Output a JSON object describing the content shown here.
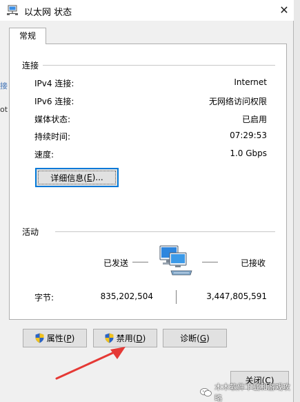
{
  "window": {
    "title": "以太网 状态",
    "close_glyph": "✕"
  },
  "tab": {
    "label": "常规"
  },
  "connection": {
    "section_label": "连接",
    "rows": [
      {
        "label": "IPv4 连接:",
        "value": "Internet"
      },
      {
        "label": "IPv6 连接:",
        "value": "无网络访问权限"
      },
      {
        "label": "媒体状态:",
        "value": "已启用"
      },
      {
        "label": "持续时间:",
        "value": "07:29:53"
      },
      {
        "label": "速度:",
        "value": "1.0 Gbps"
      }
    ],
    "details_button": {
      "text": "详细信息(",
      "mnemonic": "E",
      "suffix": ")..."
    }
  },
  "activity": {
    "section_label": "活动",
    "sent_label": "已发送",
    "received_label": "已接收",
    "bytes_label": "字节:",
    "bytes_sent": "835,202,504",
    "bytes_received": "3,447,805,591"
  },
  "buttons": {
    "properties": {
      "text": "属性(",
      "mnemonic": "P",
      "suffix": ")"
    },
    "disable": {
      "text": "禁用(",
      "mnemonic": "D",
      "suffix": ")"
    },
    "diagnose": {
      "text": "诊断(",
      "mnemonic": "G",
      "suffix": ")"
    },
    "close": {
      "text": "关闭(",
      "mnemonic": "C",
      "suffix": ")"
    }
  },
  "watermark": {
    "text": "木木软件下载和游戏攻略"
  },
  "edge_fragments": {
    "a": "接",
    "b": "ot"
  },
  "colors": {
    "accent": "#0078d7",
    "arrow": "#e53935",
    "panel_bg": "#ffffff",
    "window_bg": "#f0f0f0"
  },
  "icons": {
    "title": "network-icon",
    "activity": "network-computers-icon",
    "shield": "uac-shield-icon",
    "watermark": "wechat-icon"
  }
}
